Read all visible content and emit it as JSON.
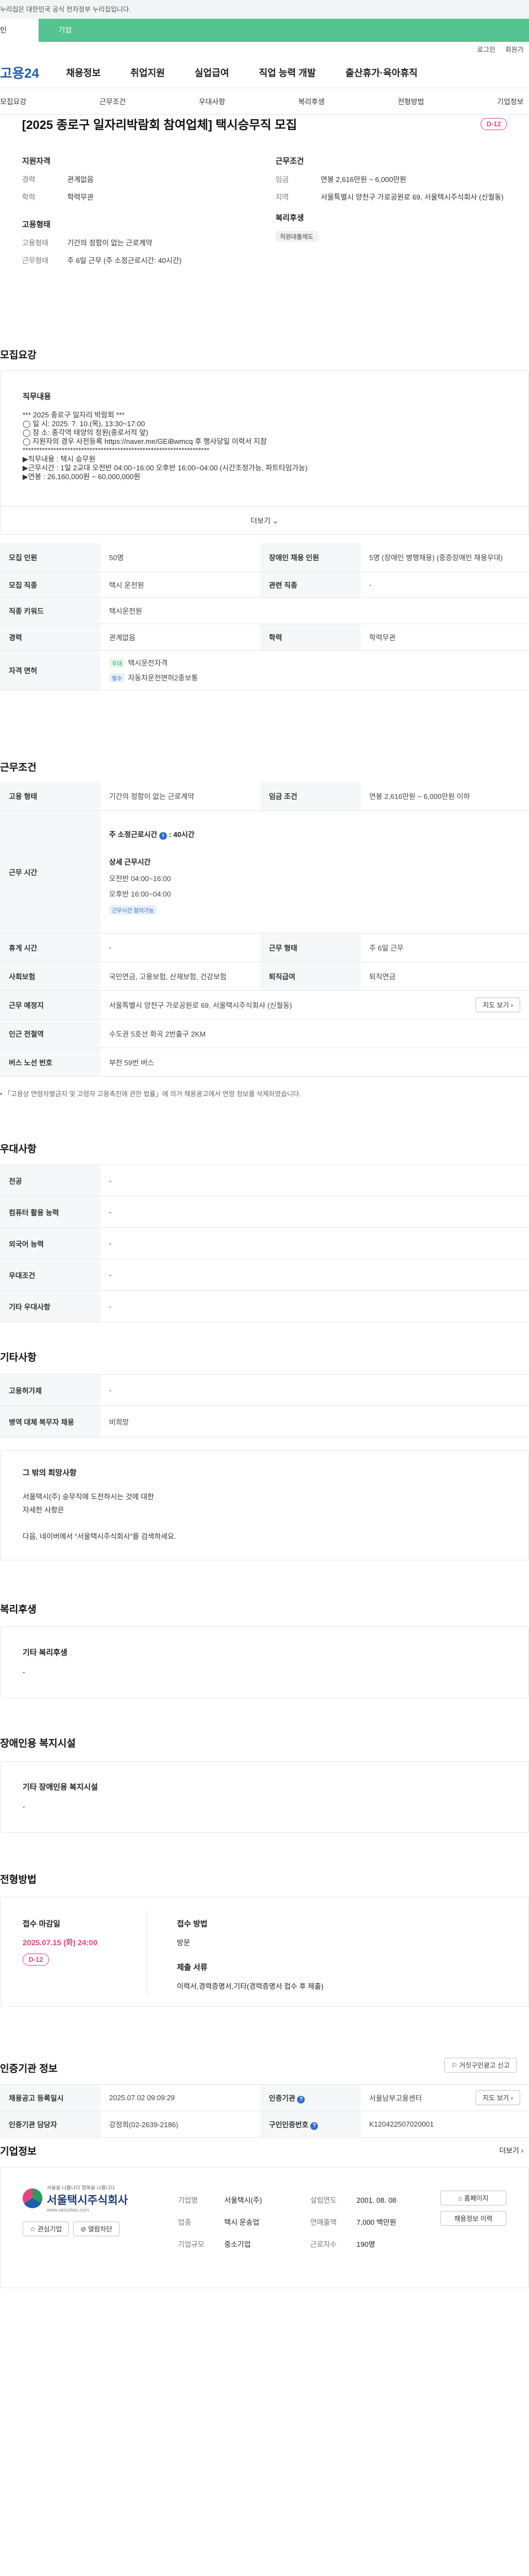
{
  "top_notice": "누리집은 대한민국 공식 전자정부 누리집입니다.",
  "user_tabs": [
    "인",
    "기업"
  ],
  "utility": [
    "로그인",
    "회원가"
  ],
  "gnb": {
    "logo": "고용24",
    "menu": [
      "채용정보",
      "취업지원",
      "실업급여",
      "직업 능력 개발",
      "출산휴가·육아휴직"
    ]
  },
  "lnb": [
    "모집요강",
    "근무조건",
    "우대사항",
    "복리후생",
    "전형방법",
    "기업정보"
  ],
  "job": {
    "title": "[2025 종로구 일자리박람회 참여업체] 택시승무직 모집",
    "dday": "D-12"
  },
  "summary": {
    "qualification": {
      "heading": "지원자격",
      "rows": [
        {
          "k": "경력",
          "v": "관계없음"
        },
        {
          "k": "학력",
          "v": "학력무관"
        }
      ]
    },
    "employment": {
      "heading": "고용형태",
      "rows": [
        {
          "k": "고용형태",
          "v": "기간의 정함이 없는 근로계약"
        },
        {
          "k": "근무형태",
          "v": "주 6일 근무 (주 소정근로시간: 40시간)"
        }
      ]
    },
    "conditions": {
      "heading": "근무조건",
      "wage_k": "임금",
      "wage_v": "연봉 2,616만원 ~ 6,000만원",
      "area_k": "지역",
      "area_v": "서울특별시 양천구 가로공원로 69, 서울택시주식회사 (신월동)"
    },
    "welfare": {
      "heading": "복리후생",
      "chip": "직원대출제도"
    }
  },
  "recruit": {
    "section": "모집요강",
    "duty_heading": "직무내용",
    "duty_lines": [
      "*** 2025 종로구 일자리 박람회 ***",
      "◯ 일 시: 2025. 7. 10.(목), 13:30~17:00",
      "◯ 장 소: 종각역 태양의 정원(종로서적 앞)",
      "◯ 지원자의 경우 사전등록  https://naver.me/GEiBwmcq 후 행사당일 이력서 지참",
      "*******************************************************************",
      "▶직무내용 : 택시 승무원",
      "▶근무시간 : 1일 2교대 오전반 04:00~16:00 오후반 16:00~04:00 (시간조정가능, 파트타임가능)",
      "▶연봉 : 26,160,000원 ~ 60,000,000원"
    ],
    "more": "더보기",
    "rows": {
      "count_k": "모집 인원",
      "count_v": "50명",
      "disabled_k": "장애인 채용 인원",
      "disabled_v": "5명 (장애인 병행채용) (중증장애인 채용우대)",
      "job_k": "모집 직종",
      "job_v": "택시 운전원",
      "related_k": "관련 직종",
      "related_v": "-",
      "keyword_k": "직종 키워드",
      "keyword_v": "택시운전원",
      "career_k": "경력",
      "career_v": "관계없음",
      "edu_k": "학력",
      "edu_v": "학력무관",
      "license_k": "자격 면허",
      "license_tag1": "우대",
      "license_v1": "택시운전자격",
      "license_tag2": "필수",
      "license_v2": "자동차운전면허2종보통"
    }
  },
  "work": {
    "section": "근무조건",
    "type_k": "고용 형태",
    "type_v": "기간의 정함이 없는 근로계약",
    "wage_k": "임금 조건",
    "wage_v": "연봉 2,616만원 ~ 6,000만원 이하",
    "hours_k": "근무 시간",
    "hours_week": "주 소정근로시간",
    "hours_week_val": "40시간",
    "hours_detail": "상세 근무시간",
    "hours_am": "오전반 04:00~16:00",
    "hours_pm": "오후반 16:00~04:00",
    "hours_tag": "근무시간 협의가능",
    "break_k": "휴게 시간",
    "break_v": "-",
    "form_k": "근무 형태",
    "form_v": "주 6일 근무",
    "insurance_k": "사회보험",
    "insurance_v": "국민연금, 고용보험, 산재보험, 건강보험",
    "severance_k": "퇴직급여",
    "severance_v": "퇴직연금",
    "place_k": "근무 예정지",
    "place_v": "서울특별시 양천구 가로공원로 69, 서울택시주식회사 (신월동)",
    "map_btn": "지도 보기",
    "subway_k": "인근 전철역",
    "subway_v": "수도권 5호선 화곡 2번출구 2KM",
    "bus_k": "버스 노선 번호",
    "bus_v": "부천 59번 버스",
    "note": "「고용상 연령차별금지 및 고령자 고용촉진에 관한 법률」에 의거 채용광고에서 연령 정보를 삭제하였습니다."
  },
  "preference": {
    "section": "우대사항",
    "rows": [
      {
        "k": "전공",
        "v": "-"
      },
      {
        "k": "컴퓨터 활용 능력",
        "v": "-"
      },
      {
        "k": "외국어 능력",
        "v": "-"
      },
      {
        "k": "우대조건",
        "v": "-"
      },
      {
        "k": "기타 우대사항",
        "v": "-"
      }
    ]
  },
  "etc": {
    "section": "기타사항",
    "rows": [
      {
        "k": "고용허가제",
        "v": "-"
      },
      {
        "k": "병역 대체 복무자 채용",
        "v": "비희망"
      }
    ],
    "wish_heading": "그 밖의 희망사항",
    "wish_lines": [
      "서울택시(주) 승무직에 도전하시는 것에 대한",
      "자세한 사항은",
      "",
      "다음, 네이버에서 \"서울택시주식회사\"를 검색하세요."
    ]
  },
  "benefits": {
    "section": "복리후생",
    "heading": "기타 복리후생",
    "value": "-"
  },
  "facility": {
    "section": "장애인용 복지시설",
    "heading": "기타 장애인용 복지시설",
    "value": "-"
  },
  "process": {
    "section": "전형방법",
    "deadline_k": "접수 마감일",
    "deadline_v": "2025.07.15 (화) 24:00",
    "dday": "D-12",
    "method_k": "접수 방법",
    "method_v": "방문",
    "docs_k": "제출 서류",
    "docs_v": "이력서,경력증명서,기타(경력증명서 접수 후 제출)"
  },
  "cert": {
    "section": "인증기관 정보",
    "report_btn": "거짓구인광고 신고",
    "date_k": "채용공고 등록일시",
    "date_v": "2025.07.02 09:09:29",
    "agency_k": "인증기관",
    "agency_v": "서울남부고용센터",
    "map_btn": "지도 보기",
    "manager_k": "인증기관 담당자",
    "manager_v": "강정희(02-2639-2186)",
    "no_k": "구인인증번호",
    "no_v": "K120422507020001"
  },
  "company": {
    "section": "기업정보",
    "more": "더보기",
    "logo_small": "서울을 나릅니다 행복을 나릅니다",
    "logo_name": "서울택시주식회사",
    "logo_url": "www.seoultaxi.com",
    "interest_btn": "관심기업",
    "block_btn": "열람차단",
    "rows": [
      {
        "k": "기업명",
        "v": "서울택시(주)"
      },
      {
        "k": "업종",
        "v": "택시 운송업"
      },
      {
        "k": "기업규모",
        "v": "중소기업"
      }
    ],
    "rows2": [
      {
        "k": "설립연도",
        "v": "2001. 08. 08"
      },
      {
        "k": "연매출액",
        "v": "7,000 백만원"
      },
      {
        "k": "근로자수",
        "v": "190명"
      }
    ],
    "home_btn": "홈페이지",
    "jobs_btn": "채용정보 이력"
  },
  "colors": {
    "accent": "#55c38f",
    "dday": "#e0457b",
    "link": "#2f6fd1",
    "brand": "#1c5fae"
  }
}
